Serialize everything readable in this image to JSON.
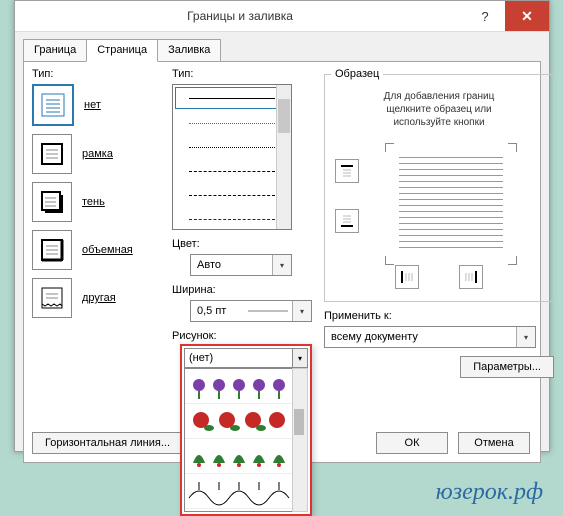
{
  "window": {
    "title": "Границы и заливка"
  },
  "tabs": {
    "border": "Граница",
    "page": "Страница",
    "shading": "Заливка",
    "active": "page"
  },
  "labels": {
    "setting": "Тип:",
    "style": "Тип:",
    "color": "Цвет:",
    "width": "Ширина:",
    "art": "Рисунок:",
    "preview": "Образец",
    "hint": "Для добавления границ\nщелкните образец или\nиспользуйте кнопки",
    "applyto": "Применить к:",
    "options": "Параметры...",
    "ok": "ОК",
    "cancel": "Отмена",
    "hrule": "Горизонтальная линия..."
  },
  "settings": [
    {
      "key": "none",
      "label": "нет"
    },
    {
      "key": "box",
      "label": "рамка"
    },
    {
      "key": "shadow",
      "label": "тень"
    },
    {
      "key": "threeD",
      "label": "объемная"
    },
    {
      "key": "custom",
      "label": "другая"
    }
  ],
  "color": {
    "value": "Авто"
  },
  "width": {
    "value": "0,5 пт"
  },
  "art": {
    "value": "(нет)"
  },
  "applyto": {
    "value": "всему документу"
  },
  "watermark": "юзерок.рф"
}
